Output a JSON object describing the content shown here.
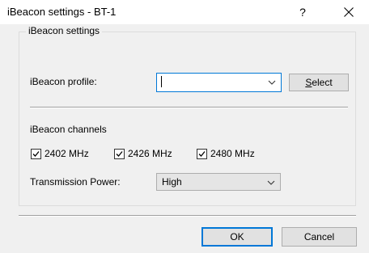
{
  "window": {
    "title": "iBeacon settings - BT-1",
    "help_label": "?",
    "close_icon": "close-icon"
  },
  "group": {
    "legend": "iBeacon settings"
  },
  "profile": {
    "label": "iBeacon profile:",
    "value": "",
    "select_button_prefix": "",
    "select_button_mnemonic": "S",
    "select_button_rest": "elect"
  },
  "channels": {
    "heading": "iBeacon channels",
    "items": [
      {
        "label": "2402 MHz",
        "checked": true
      },
      {
        "label": "2426 MHz",
        "checked": true
      },
      {
        "label": "2480 MHz",
        "checked": true
      }
    ]
  },
  "power": {
    "label": "Transmission Power:",
    "value": "High"
  },
  "footer": {
    "ok_label": "OK",
    "cancel_label": "Cancel"
  },
  "colors": {
    "accent": "#0078d7",
    "dialog_bg": "#f0f0f0"
  }
}
